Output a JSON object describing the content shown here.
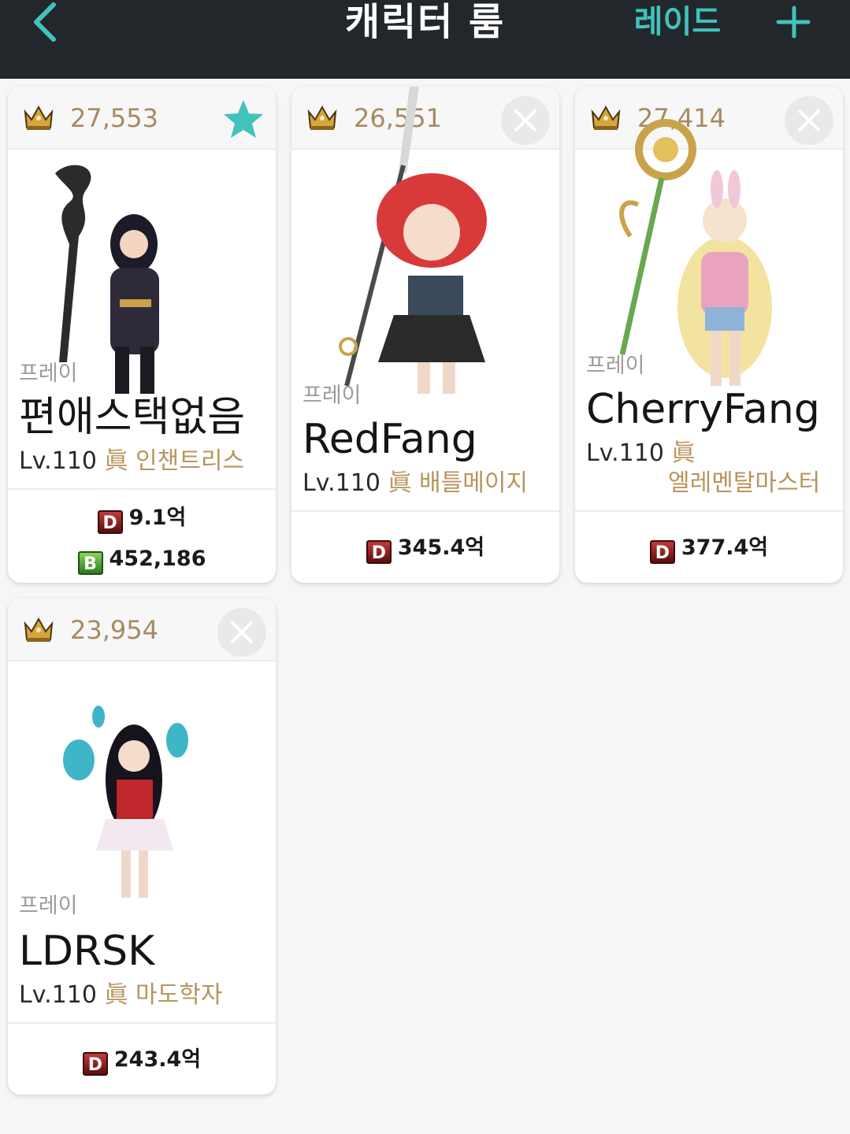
{
  "header": {
    "title": "캐릭터 룸",
    "raid_label": "레이드",
    "back_icon": "chevron-left-icon",
    "add_icon": "plus-icon"
  },
  "colors": {
    "header_bg": "#22272c",
    "accent": "#41c2bd",
    "score_text": "#a78a62",
    "job_text": "#b8945c",
    "card_bg": "#ffffff",
    "page_bg": "#f6f6f6"
  },
  "cards": [
    {
      "score": "27,553",
      "status_icon": "star-icon",
      "server": "프레이",
      "name": "편애스택없음",
      "level": "Lv.110",
      "awakening_mark": "眞",
      "job": "인챈트리스",
      "stats": [
        {
          "badge": "D",
          "value": "9.1억"
        },
        {
          "badge": "B",
          "value": "452,186"
        }
      ]
    },
    {
      "score": "26,551",
      "status_icon": "close-icon",
      "server": "프레이",
      "name": "RedFang",
      "level": "Lv.110",
      "awakening_mark": "眞",
      "job": "배틀메이지",
      "stats": [
        {
          "badge": "D",
          "value": "345.4억"
        }
      ]
    },
    {
      "score": "27,414",
      "status_icon": "close-icon",
      "server": "프레이",
      "name": "CherryFang",
      "level": "Lv.110",
      "awakening_mark": "眞",
      "job": "엘레멘탈마스터",
      "stats": [
        {
          "badge": "D",
          "value": "377.4억"
        }
      ]
    },
    {
      "score": "23,954",
      "status_icon": "close-icon",
      "server": "프레이",
      "name": "LDRSK",
      "level": "Lv.110",
      "awakening_mark": "眞",
      "job": "마도학자",
      "stats": [
        {
          "badge": "D",
          "value": "243.4억"
        }
      ]
    }
  ]
}
